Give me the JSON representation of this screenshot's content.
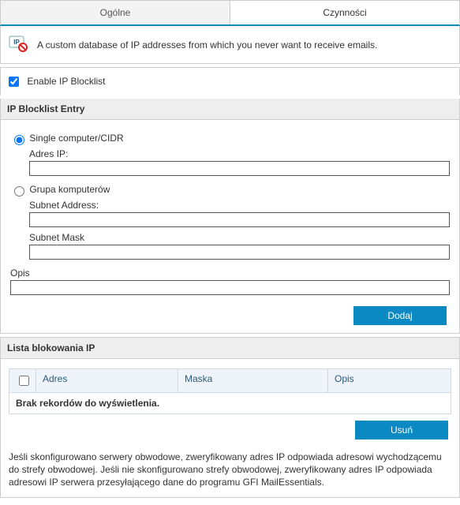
{
  "tabs": {
    "general": "Ogólne",
    "actions": "Czynności"
  },
  "info": {
    "text": "A custom database of IP addresses from which you never want to receive emails."
  },
  "enable": {
    "label": "Enable IP Blocklist",
    "checked": true
  },
  "entry": {
    "header": "IP Blocklist Entry",
    "single": {
      "label": "Single computer/CIDR",
      "ip_label": "Adres IP:",
      "ip_value": ""
    },
    "group": {
      "label": "Grupa komputerów",
      "subnet_addr_label": "Subnet Address:",
      "subnet_addr_value": "",
      "subnet_mask_label": "Subnet Mask",
      "subnet_mask_value": ""
    },
    "desc_label": "Opis",
    "desc_value": "",
    "add_btn": "Dodaj"
  },
  "list": {
    "header": "Lista blokowania IP",
    "columns": {
      "addr": "Adres",
      "mask": "Maska",
      "opis": "Opis"
    },
    "empty": "Brak rekordów do wyświetlenia.",
    "delete_btn": "Usuń"
  },
  "footer": {
    "text": "Jeśli skonfigurowano serwery obwodowe, zweryfikowany adres IP odpowiada adresowi wychodzącemu do strefy obwodowej. Jeśli nie skonfigurowano strefy obwodowej, zweryfikowany adres IP odpowiada adresowi IP serwera przesyłającego dane do programu GFI MailEssentials."
  }
}
